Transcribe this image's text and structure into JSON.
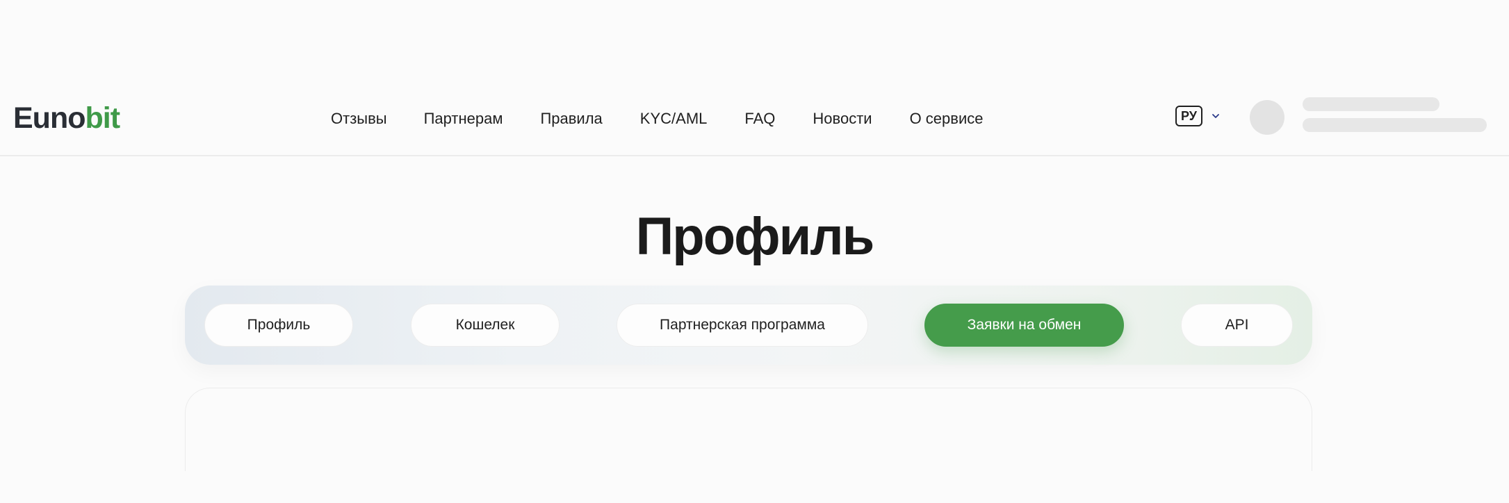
{
  "header": {
    "logo": {
      "part1": "Euno",
      "part2": "bit"
    },
    "nav": [
      {
        "label": "Отзывы"
      },
      {
        "label": "Партнерам"
      },
      {
        "label": "Правила"
      },
      {
        "label": "KYC/AML"
      },
      {
        "label": "FAQ"
      },
      {
        "label": "Новости"
      },
      {
        "label": "О сервисе"
      }
    ],
    "language": {
      "label": "РУ",
      "icon": "chevron-down-icon"
    },
    "user": {
      "avatar_icon": "avatar-placeholder"
    }
  },
  "page": {
    "title": "Профиль"
  },
  "tabs": [
    {
      "label": "Профиль",
      "active": false
    },
    {
      "label": "Кошелек",
      "active": false
    },
    {
      "label": "Партнерская программа",
      "active": false
    },
    {
      "label": "Заявки на обмен",
      "active": true
    },
    {
      "label": "API",
      "active": false
    }
  ],
  "colors": {
    "accent": "#459c4b",
    "logo_dark": "#2a2e35",
    "logo_green": "#3f9a48"
  }
}
